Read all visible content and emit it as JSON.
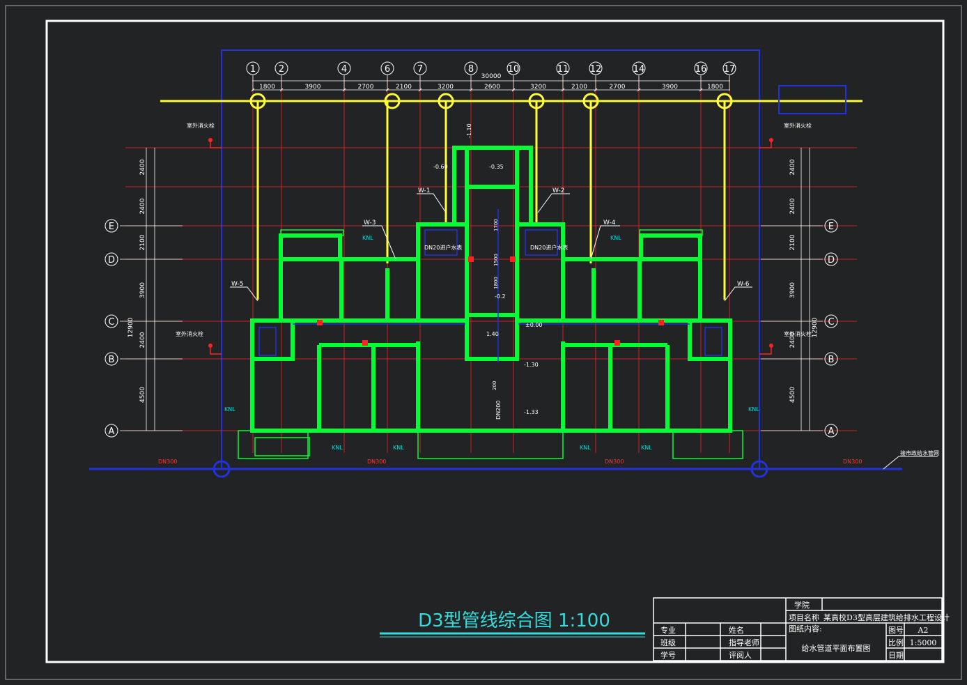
{
  "colors": {
    "background": "#222324",
    "frame": "#ffffff",
    "wall": "#00ff33",
    "grid": "#ff2222",
    "pipe_yellow": "#ffff33",
    "main_blue": "#2233dd",
    "dim": "#ffffff",
    "cyan": "#00dddd",
    "title": "#33dddd"
  },
  "axes_top": [
    "1",
    "2",
    "4",
    "6",
    "7",
    "8",
    "10",
    "11",
    "12",
    "14",
    "16",
    "17"
  ],
  "axes_side": [
    "E",
    "D",
    "C",
    "B",
    "A"
  ],
  "dims_top": {
    "total": "30000",
    "segments": [
      "1800",
      "3900",
      "2700",
      "2100",
      "3200",
      "2600",
      "3200",
      "2100",
      "2700",
      "3900",
      "1800"
    ]
  },
  "dims_side": {
    "total": "12900",
    "segments": [
      "2400",
      "2400",
      "2100",
      "3900",
      "2400",
      "4500"
    ]
  },
  "labels": {
    "fire_hydrant": "室外消火栓",
    "city_pipe": "接市政给水管网",
    "dn300": "DN300",
    "dn200": "DN200",
    "dn20": "DN20",
    "dn20_label": "DN20进户水表",
    "knl": "KNL",
    "risers": [
      "W-1",
      "W-2",
      "W-3",
      "W-4",
      "W-5",
      "W-6"
    ],
    "levels": [
      "-1.10",
      "-0.60",
      "-0.35",
      "±0.00",
      "-1.30",
      "-1.33",
      "1.40",
      "-0.2",
      "200",
      "1700",
      "1500",
      "1800"
    ]
  },
  "drawing_title": "D3型管线综合图 1:100",
  "title_block": {
    "school": "学院",
    "project_label": "项目名称",
    "project_value": "某高校D3型高层建筑给排水工程设计",
    "content_label": "图纸内容:",
    "content_value": "给水管道平面布置图",
    "major": "专业",
    "name": "姓名",
    "class": "班级",
    "advisor": "指导老师",
    "student_no": "学号",
    "reviewer": "评阅人",
    "drawing_no_label": "图号",
    "drawing_no": "A2",
    "scale_label": "比例",
    "scale": "1:5000",
    "date_label": "日期"
  }
}
